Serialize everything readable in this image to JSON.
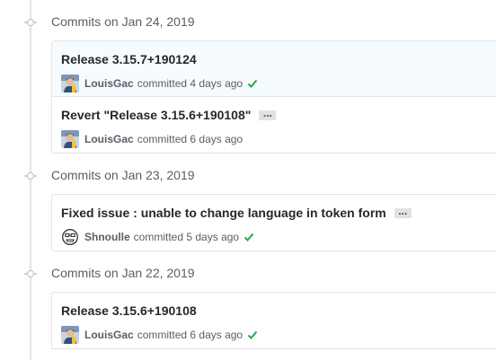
{
  "groups": [
    {
      "title": "Commits on Jan 24, 2019",
      "commits": [
        {
          "title": "Release 3.15.7+190124",
          "author": "LouisGac",
          "verb": "committed",
          "time": "4 days ago",
          "status": "success",
          "highlighted": true,
          "has_ellipsis": false
        },
        {
          "title": "Revert \"Release 3.15.6+190108\"",
          "author": "LouisGac",
          "verb": "committed",
          "time": "6 days ago",
          "status": "none",
          "highlighted": false,
          "has_ellipsis": true,
          "ellipsis_label": "..."
        }
      ]
    },
    {
      "title": "Commits on Jan 23, 2019",
      "commits": [
        {
          "title": "Fixed issue : unable to change language in token form",
          "author": "Shnoulle",
          "verb": "committed",
          "time": "5 days ago",
          "status": "success",
          "highlighted": false,
          "has_ellipsis": true,
          "ellipsis_label": "..."
        }
      ]
    },
    {
      "title": "Commits on Jan 22, 2019",
      "commits": [
        {
          "title": "Release 3.15.6+190108",
          "author": "LouisGac",
          "verb": "committed",
          "time": "6 days ago",
          "status": "success",
          "highlighted": false,
          "has_ellipsis": false
        }
      ]
    }
  ],
  "colors": {
    "success": "#28a745",
    "timeline": "#e1e4e8",
    "highlight_bg": "#f6fbff"
  },
  "icons": {
    "commit_node": "git-commit-icon",
    "status_success": "check-icon",
    "avatar_louisgac": "avatar-louisgac",
    "avatar_shnoulle": "avatar-shnoulle"
  }
}
